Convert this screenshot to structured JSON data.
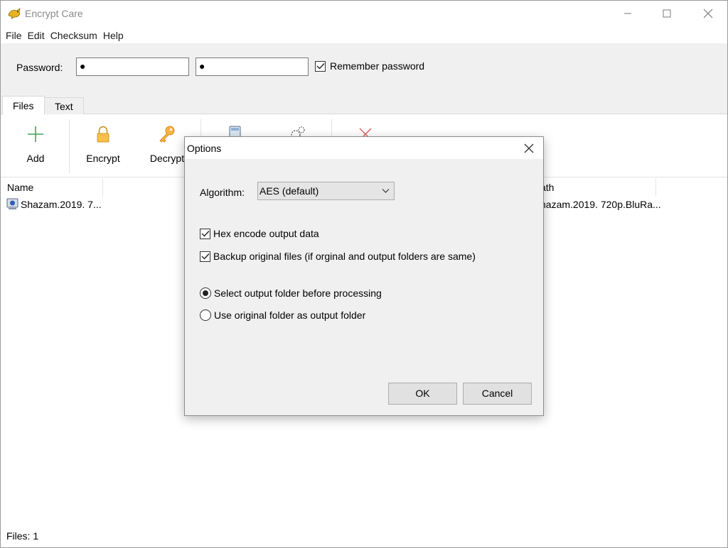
{
  "window": {
    "title": "Encrypt Care",
    "controls": {
      "minimize": "minimize",
      "maximize": "maximize",
      "close": "close"
    }
  },
  "menu": [
    {
      "label": "File"
    },
    {
      "label": "Edit"
    },
    {
      "label": "Checksum"
    },
    {
      "label": "Help"
    }
  ],
  "password_panel": {
    "label": "Password:",
    "password_value": "●",
    "confirm_value": "●",
    "remember_label": "Remember password",
    "remember_checked": true
  },
  "tabs": [
    {
      "label": "Files",
      "active": true
    },
    {
      "label": "Text",
      "active": false
    }
  ],
  "toolbar": {
    "add_label": "Add",
    "encrypt_label": "Encrypt",
    "decrypt_label": "Decrypt",
    "icons": [
      "plus-icon",
      "lock-icon",
      "key-icon",
      "calculator-icon",
      "gears-icon",
      "delete-icon"
    ],
    "colors": {
      "add": "#3aa655",
      "encrypt": "#f2b13a",
      "decrypt": "#f2a43a",
      "delete": "#e05050"
    }
  },
  "file_list": {
    "columns": {
      "name": "Name",
      "path": "ath"
    },
    "rows": [
      {
        "name": "Shazam.2019. 7...",
        "path": "hazam.2019. 720p.BluRa..."
      }
    ]
  },
  "status": {
    "text": "Files: 1"
  },
  "dialog": {
    "title": "Options",
    "algorithm_label": "Algorithm:",
    "algorithm_value": "AES (default)",
    "hex_label": "Hex encode output data",
    "hex_checked": true,
    "backup_label": "Backup original files (if orginal and output folders are same)",
    "backup_checked": true,
    "radio_select_label": "Select output folder before processing",
    "radio_original_label": "Use original folder as output folder",
    "selected_radio": "select",
    "ok_label": "OK",
    "cancel_label": "Cancel"
  }
}
